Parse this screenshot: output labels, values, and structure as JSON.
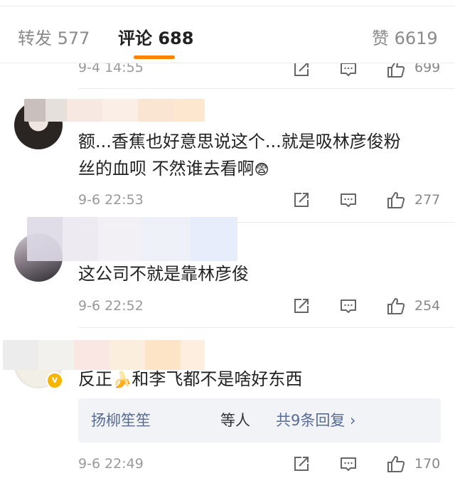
{
  "tabs": [
    {
      "label": "转发 577"
    },
    {
      "label": "评论 688"
    },
    {
      "label": "赞 6619"
    }
  ],
  "top_partial": {
    "time": "9-4 14:55",
    "likes": "699"
  },
  "comments": [
    {
      "text_line1": "额...香蕉也好意思说这个...就是吸林彦俊粉",
      "text_line2": "丝的血呗 不然谁去看啊",
      "emoji": "😨",
      "time": "9-6 22:53",
      "likes": "277"
    },
    {
      "text_line1": "这公司不就是靠林彦俊",
      "time": "9-6 22:52",
      "likes": "254"
    },
    {
      "text_before": "反正",
      "emoji": "🍌",
      "text_after": "和李飞都不是啥好东西",
      "verified": "v",
      "reply_names": "扬柳笙笙",
      "reply_mid": "等人",
      "reply_count": "共9条回复 ›",
      "time": "9-6 22:49",
      "likes": "170"
    }
  ],
  "icons": [
    "share-icon",
    "comment-icon",
    "like-icon"
  ],
  "colors": {
    "accent": "#ff8200",
    "link": "#576b95",
    "verified": "#f7b500"
  }
}
